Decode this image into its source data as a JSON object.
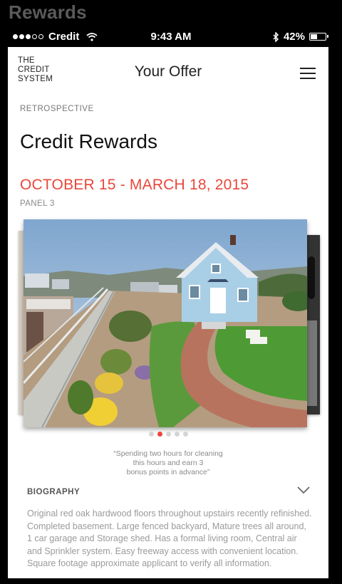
{
  "window": {
    "title": "Rewards"
  },
  "status": {
    "carrier": "Credit",
    "time": "9:43 AM",
    "battery": "42%",
    "signal_bars_filled": 3,
    "signal_bars_total": 5
  },
  "header": {
    "logo_lines": [
      "THE",
      "CREDIT",
      "SYSTEM"
    ],
    "title": "Your Offer",
    "menu_icon": "hamburger-menu-icon"
  },
  "content": {
    "eyebrow": "RETROSPECTIVE",
    "title": "Credit Rewards",
    "dates": "OCTOBER 15 - MARCH 18, 2015",
    "panel": "PANEL 3",
    "carousel": {
      "slides": 5,
      "active": 2
    },
    "quote_lines": [
      "“Spending two hours for cleaning",
      "this hours and earn 3",
      "bonus points in advance”"
    ],
    "biography": {
      "heading": "BIOGRAPHY",
      "text": "Original red oak hardwood floors throughout upstairs recently refinished. Completed basement. Large fenced backyard, Mature trees all around, 1 car garage and Storage shed. Has a formal living room, Central air and Sprinkler system. Easy freeway access with convenient location. Square footage approximate applicant to verify all information."
    }
  },
  "colors": {
    "accent": "#e8473a",
    "sky": "#8fb4d6",
    "house": "#a9cfe6",
    "grass": "#4f8f3a"
  }
}
